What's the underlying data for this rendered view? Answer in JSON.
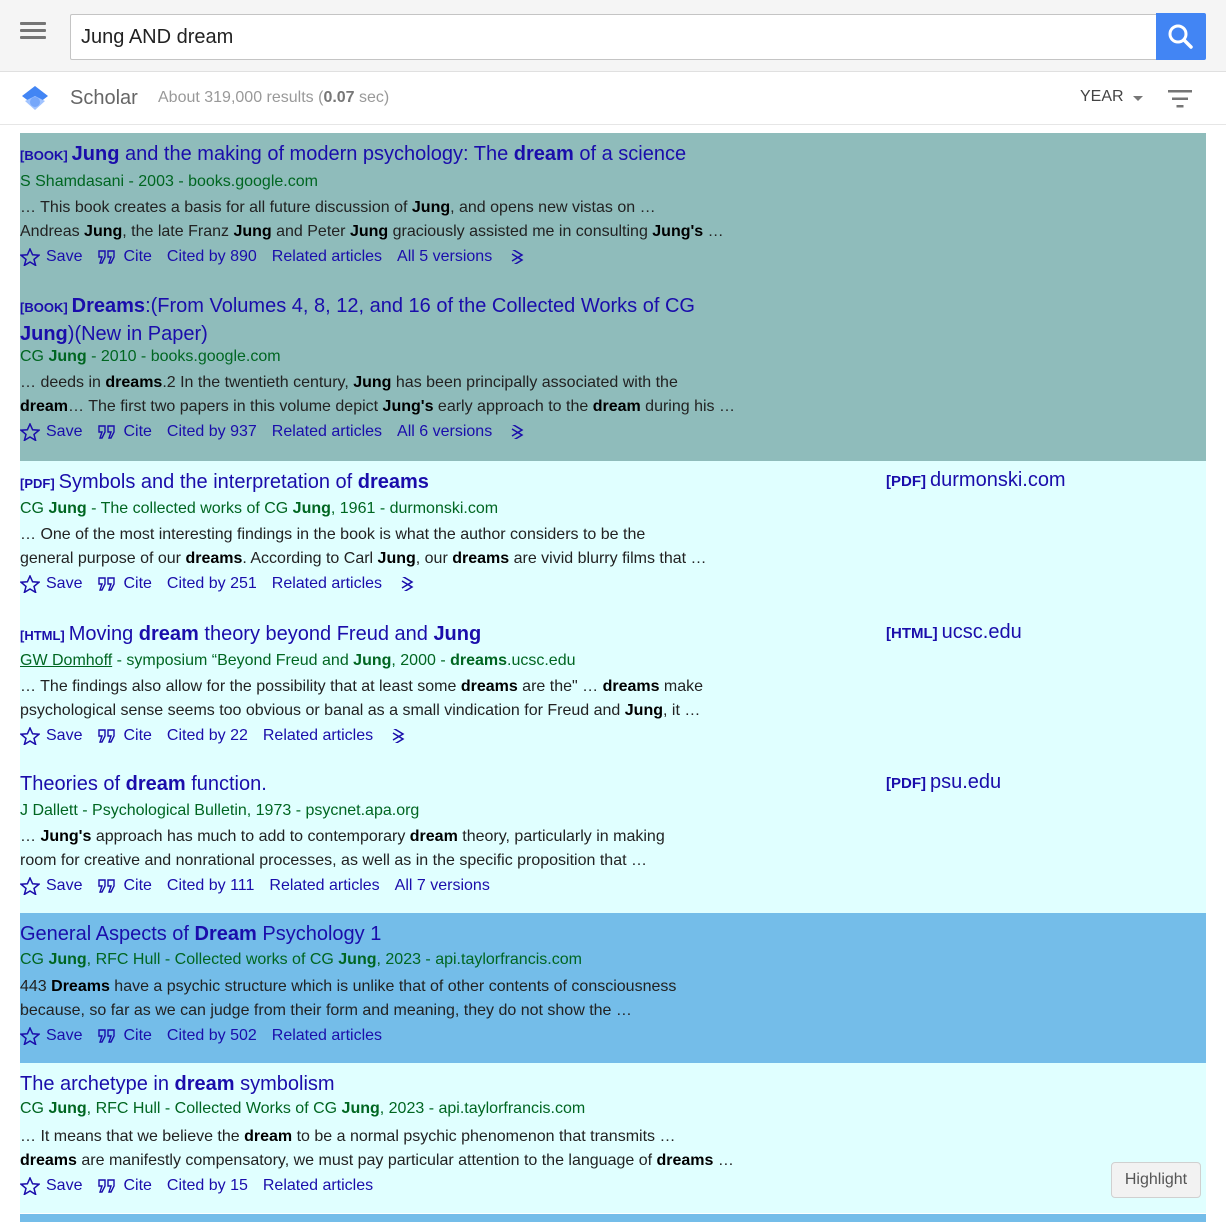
{
  "search": {
    "query": "Jung AND dream"
  },
  "header": {
    "brand": "Scholar",
    "stats_prefix": "About 319,000 results (",
    "stats_time": "0.07",
    "stats_suffix": " sec)",
    "year_label": "YEAR"
  },
  "actions": {
    "save": "Save",
    "cite": "Cite",
    "related": "Related articles"
  },
  "results": [
    {
      "type": "[BOOK]",
      "cited": "Cited by 890",
      "versions": "All 5 versions"
    },
    {
      "type": "[BOOK]",
      "cited": "Cited by 937",
      "versions": "All 6 versions"
    },
    {
      "type": "[PDF]",
      "cited": "Cited by 251",
      "side_type": "[PDF]",
      "side_domain": "durmonski.com"
    },
    {
      "type": "[HTML]",
      "cited": "Cited by 22",
      "side_type": "[HTML]",
      "side_domain": "ucsc.edu"
    },
    {
      "cited": "Cited by 111",
      "versions": "All 7 versions",
      "side_type": "[PDF]",
      "side_domain": "psu.edu"
    },
    {
      "cited": "Cited by 502"
    },
    {
      "cited": "Cited by 15"
    }
  ],
  "texts": {
    "r1_title_a": "Jung",
    "r1_title_b": " and the making of modern psychology: The ",
    "r1_title_c": "dream",
    "r1_title_d": " of a science",
    "r1_authors": "S Shamdasani - 2003 - books.google.com",
    "r1_s1": "… This book creates a basis for all future discussion of ",
    "r1_s2": "Jung",
    "r1_s3": ", and opens new vistas on …",
    "r1_s4": "Andreas ",
    "r1_s5": "Jung",
    "r1_s6": ", the late Franz ",
    "r1_s7": "Jung",
    "r1_s8": " and Peter ",
    "r1_s9": "Jung",
    "r1_s10": " graciously assisted me in consulting ",
    "r1_s11": "Jung's",
    "r1_s12": " …",
    "r2_title_a": "Dreams",
    "r2_title_b": ":(From Volumes 4, 8, 12, and 16 of the Collected Works of CG ",
    "r2_title_c": "Jung",
    "r2_title_d": ")(New in Paper)",
    "r2_auth_a": "CG ",
    "r2_auth_b": "Jung",
    "r2_auth_c": " - 2010 - books.google.com",
    "r2_s1": "… deeds in ",
    "r2_s2": "dreams",
    "r2_s3": ".2 In the twentieth century, ",
    "r2_s4": "Jung",
    "r2_s5": " has been principally associated with the",
    "r2_s6": "dream",
    "r2_s7": "… The first two papers in this volume depict ",
    "r2_s8": "Jung's",
    "r2_s9": " early approach to the ",
    "r2_s10": "dream",
    "r2_s11": " during his …",
    "r3_title_a": "Symbols and the interpretation of ",
    "r3_title_b": "dreams",
    "r3_auth_a": "CG ",
    "r3_auth_b": "Jung",
    "r3_auth_c": " - The collected works of CG ",
    "r3_auth_d": "Jung",
    "r3_auth_e": ", 1961 - durmonski.com",
    "r3_s1": "… One of the most interesting findings in the book is what the author considers to be the",
    "r3_s2": "general purpose of our ",
    "r3_s3": "dreams",
    "r3_s4": ". According to Carl ",
    "r3_s5": "Jung",
    "r3_s6": ", our ",
    "r3_s7": "dreams",
    "r3_s8": " are vivid blurry films that …",
    "r4_title_a": "Moving ",
    "r4_title_b": "dream",
    "r4_title_c": " theory beyond Freud and ",
    "r4_title_d": "Jung",
    "r4_auth_a": "GW Domhoff",
    "r4_auth_b": " - symposium “Beyond Freud and ",
    "r4_auth_c": "Jung",
    "r4_auth_d": ", 2000 - ",
    "r4_auth_e": "dreams",
    "r4_auth_f": ".ucsc.edu",
    "r4_s1": "… The findings also allow for the possibility that at least some ",
    "r4_s2": "dreams",
    "r4_s3": " are the\" … ",
    "r4_s4": "dreams",
    "r4_s5": " make",
    "r4_s6": "psychological sense seems too obvious or banal as a small vindication for Freud and ",
    "r4_s7": "Jung",
    "r4_s8": ", it …",
    "r5_title_a": "Theories of ",
    "r5_title_b": "dream",
    "r5_title_c": " function.",
    "r5_authors": "J Dallett - Psychological Bulletin, 1973 - psycnet.apa.org",
    "r5_s1": "… ",
    "r5_s2": "Jung's",
    "r5_s3": " approach has much to add to contemporary ",
    "r5_s4": "dream",
    "r5_s5": " theory, particularly in making",
    "r5_s6": "room for creative and nonrational processes, as well as in the specific proposition that …",
    "r6_title_a": "General Aspects of ",
    "r6_title_b": "Dream",
    "r6_title_c": " Psychology 1",
    "r6_auth_a": "CG ",
    "r6_auth_b": "Jung",
    "r6_auth_c": ", RFC Hull - Collected works of CG ",
    "r6_auth_d": "Jung",
    "r6_auth_e": ", 2023 - api.taylorfrancis.com",
    "r6_s1": "443 ",
    "r6_s2": "Dreams",
    "r6_s3": " have a psychic structure which is unlike that of other contents of consciousness",
    "r6_s4": "because, so far as we can judge from their form and meaning, they do not show the …",
    "r7_title_a": "The archetype in ",
    "r7_title_b": "dream",
    "r7_title_c": " symbolism",
    "r7_auth_a": "CG ",
    "r7_auth_b": "Jung",
    "r7_auth_c": ", RFC Hull - Collected Works of CG ",
    "r7_auth_d": "Jung",
    "r7_auth_e": ", 2023 - api.taylorfrancis.com",
    "r7_s1": "… It means that we believe the ",
    "r7_s2": "dream",
    "r7_s3": " to be a normal psychic phenomenon that transmits …",
    "r7_s4": "dreams",
    "r7_s5": " are manifestly compensatory, we must pay particular attention to the language of ",
    "r7_s6": "dreams",
    "r7_s7": " …"
  },
  "highlight_label": "Highlight",
  "colors": {
    "accent": "#4285f4",
    "link": "#1a0dab",
    "green": "#006621",
    "teal_bg": "#8fbcbb",
    "cyan_bg": "#e0ffff",
    "blue_bg": "#74bde9"
  },
  "icons": [
    "menu-icon",
    "search-icon",
    "scholar-logo-icon",
    "caret-down-icon",
    "filter-icon",
    "star-icon",
    "quote-icon",
    "double-chevron-icon"
  ]
}
